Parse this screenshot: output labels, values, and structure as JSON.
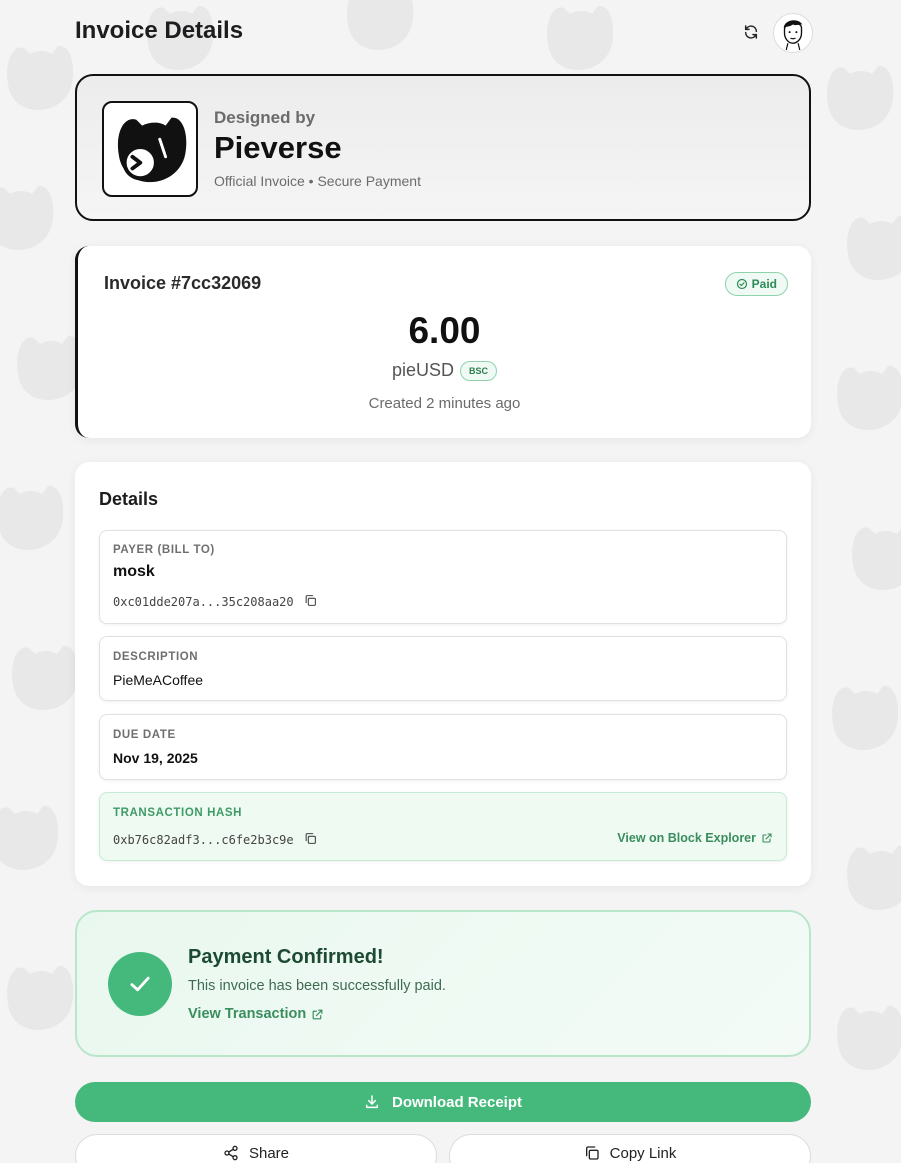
{
  "header": {
    "title": "Invoice Details",
    "refresh_icon": "refresh-icon",
    "avatar_icon": "avatar-illustration"
  },
  "brand": {
    "designed_by": "Designed by",
    "name": "Pieverse",
    "subtitle": "Official Invoice • Secure Payment",
    "logo_icon": "pieverse-cat-logo"
  },
  "invoice": {
    "number": "Invoice #7cc32069",
    "status": "Paid",
    "amount": "6.00",
    "currency": "pieUSD",
    "chain": "BSC",
    "created": "Created 2 minutes ago"
  },
  "details": {
    "title": "Details",
    "payer": {
      "label": "PAYER (BILL TO)",
      "name": "mosk",
      "address": "0xc01dde207a...35c208aa20"
    },
    "description": {
      "label": "DESCRIPTION",
      "value": "PieMeACoffee"
    },
    "due_date": {
      "label": "DUE DATE",
      "value": "Nov 19, 2025"
    },
    "transaction": {
      "label": "TRANSACTION HASH",
      "hash": "0xb76c82adf3...c6fe2b3c9e",
      "explorer_link": "View on Block Explorer"
    }
  },
  "confirmation": {
    "title": "Payment Confirmed!",
    "description": "This invoice has been successfully paid.",
    "link": "View Transaction"
  },
  "actions": {
    "download": "Download Receipt",
    "share": "Share",
    "copy_link": "Copy Link"
  },
  "colors": {
    "accent_green": "#45b97c",
    "dark": "#111111",
    "background": "#f4f4f4"
  }
}
